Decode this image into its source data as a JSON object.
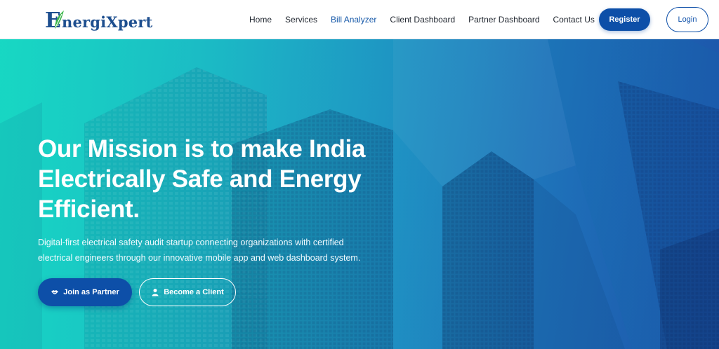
{
  "brand": {
    "name": "nergiXpert",
    "logo_letter": "E",
    "primary_color": "#0d4fa8",
    "logo_text_color": "#1e4f8f",
    "leaf_color": "#3bb54a"
  },
  "nav": {
    "items": [
      {
        "label": "Home"
      },
      {
        "label": "Services"
      },
      {
        "label": "Bill Analyzer",
        "active": true
      },
      {
        "label": "Client Dashboard"
      },
      {
        "label": "Partner Dashboard"
      },
      {
        "label": "Contact Us"
      }
    ],
    "register_label": "Register",
    "login_label": "Login"
  },
  "hero": {
    "title_lines": [
      "Our Mission is to make India",
      "Electrically Safe and Energy",
      "Efficient."
    ],
    "subtitle_lines": [
      "Digital-first electrical safety audit startup connecting organizations with certified",
      "electrical engineers through our innovative mobile app and web dashboard system."
    ],
    "partner_button": {
      "label": "Join as Partner",
      "icon": "handshake-icon"
    },
    "client_button": {
      "label": "Become a Client",
      "icon": "user-icon"
    },
    "background": "skyscrapers-photo"
  }
}
